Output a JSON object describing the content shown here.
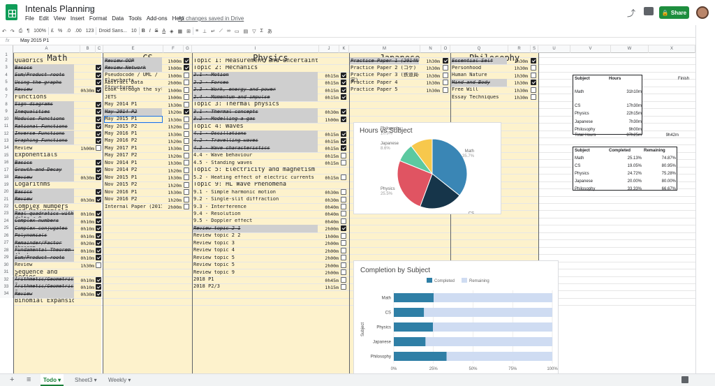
{
  "doc": {
    "title": "Intenals Planning",
    "menus": [
      "File",
      "Edit",
      "View",
      "Insert",
      "Format",
      "Data",
      "Tools",
      "Add-ons",
      "Help"
    ],
    "saved": "All changes saved in Drive",
    "share": "Share"
  },
  "toolbar": {
    "zoom": "100%",
    "currency": "£",
    "percent": "%",
    "dec0": ".0",
    "dec00": ".00",
    "format": "123",
    "font": "Droid Sans...",
    "size": "10",
    "bold": "B",
    "italic": "I",
    "strike": "S",
    "underline": "A"
  },
  "formula": {
    "fx": "fx",
    "value": "May 2015 P1"
  },
  "columns": [
    "A",
    "B",
    "C",
    "E",
    "F",
    "G",
    "I",
    "J",
    "K",
    "M",
    "N",
    "O",
    "Q",
    "R",
    "S",
    "U",
    "V",
    "W",
    "X"
  ],
  "subjects": [
    "Math",
    "CS",
    "Physics",
    "Japanese",
    "Philosophy"
  ],
  "rows": [
    "1",
    "2",
    "3",
    "4",
    "5",
    "6",
    "7",
    "8",
    "9",
    "10",
    "11",
    "12",
    "13",
    "14",
    "15",
    "16",
    "17",
    "18",
    "19",
    "20",
    "21",
    "22",
    "23",
    "24",
    "25",
    "26",
    "27",
    "28",
    "29",
    "30",
    "31",
    "32",
    "33",
    "34"
  ],
  "math": [
    {
      "r": 2,
      "t": "Quadrics",
      "big": true
    },
    {
      "r": 3,
      "t": "Basics",
      "d": true,
      "c": true
    },
    {
      "r": 4,
      "t": "Sum/Product roots",
      "d": true,
      "c": true
    },
    {
      "r": 5,
      "t": "Using the graphs",
      "d": true,
      "c": true
    },
    {
      "r": 6,
      "t": "Review",
      "d": true,
      "tm": "0h30m",
      "c": true
    },
    {
      "r": 7,
      "t": "Functions",
      "big": true
    },
    {
      "r": 8,
      "t": "Sign diagrams",
      "d": true,
      "c": true
    },
    {
      "r": 9,
      "t": "Inequalities",
      "d": true,
      "c": true
    },
    {
      "r": 10,
      "t": "Modulus Functions",
      "d": true,
      "c": true
    },
    {
      "r": 11,
      "t": "Rational Functions",
      "d": true,
      "c": true
    },
    {
      "r": 12,
      "t": "Inverse Functions",
      "d": true,
      "c": true
    },
    {
      "r": 13,
      "t": "Graphing Functions",
      "d": true,
      "c": true
    },
    {
      "r": 14,
      "t": "Review",
      "tm": "1h00m",
      "c": false
    },
    {
      "r": 15,
      "t": "Exponentials",
      "big": true
    },
    {
      "r": 16,
      "t": "Basics",
      "d": true,
      "c": true
    },
    {
      "r": 17,
      "t": "Growth and Decay",
      "d": true,
      "c": true
    },
    {
      "r": 18,
      "t": "Review",
      "d": true,
      "tm": "0h30m",
      "c": true
    },
    {
      "r": 19,
      "t": "Logarithms",
      "big": true
    },
    {
      "r": 20,
      "t": "Basics",
      "d": true,
      "c": true
    },
    {
      "r": 21,
      "t": "Review",
      "d": true,
      "tm": "0h30m",
      "c": true
    },
    {
      "r": 22,
      "t": "Complex Numbers",
      "t2": "and Polynomials",
      "big": true
    },
    {
      "r": 23,
      "t": "Real quadratics with",
      "t2": "delta < 0",
      "d": true,
      "tm": "0h10m",
      "c": true
    },
    {
      "r": 24,
      "t": "Complex numbers",
      "d": true,
      "tm": "0h10m",
      "c": true
    },
    {
      "r": 25,
      "t": "Complex conjugates",
      "d": true,
      "tm": "0h10m",
      "c": true
    },
    {
      "r": 26,
      "t": "Polynomials",
      "d": true,
      "tm": "0h10m",
      "c": true
    },
    {
      "r": 27,
      "t": "Remainder/Factor",
      "t2": "theorem",
      "d": true,
      "tm": "0h20m",
      "c": true
    },
    {
      "r": 28,
      "t": "Fundamental Theorem of",
      "t2": "Algebra",
      "d": true,
      "tm": "0h10m",
      "c": true
    },
    {
      "r": 29,
      "t": "Sum/Product roots",
      "d": true,
      "tm": "0h10m",
      "c": true
    },
    {
      "r": 30,
      "t": "Review",
      "tm": "1h30m",
      "c": false
    },
    {
      "r": 31,
      "t": "Sequence and",
      "t2": "Series",
      "big": true
    },
    {
      "r": 32,
      "t": "Arithmetic/Geometric",
      "t2": "Sequences",
      "d": true,
      "tm": "0h10m",
      "c": true
    },
    {
      "r": 33,
      "t": "Arithmetic/Geometric",
      "t2": "Series",
      "d": true,
      "tm": "0h10m",
      "c": true
    },
    {
      "r": 34,
      "t": "Review",
      "d": true,
      "tm": "0h30m",
      "c": true
    },
    {
      "r": 35,
      "t": "Binomial Expansion",
      "big": true
    }
  ],
  "cs": [
    {
      "r": 2,
      "t": "Review OOP",
      "d": true,
      "tm": "1h00m",
      "c": true
    },
    {
      "r": 3,
      "t": "Review Network",
      "d": true,
      "tm": "1h00m",
      "c": true
    },
    {
      "r": 4,
      "t": "Pseudocode / UML /",
      "t2": "Flowcharts",
      "tm": "1h00m",
      "c": false
    },
    {
      "r": 5,
      "t": "Abstract Data",
      "t2": "Structures",
      "tm": "2h00m",
      "c": false
    },
    {
      "r": 6,
      "t": "Look through the syllab",
      "tm": "1h00m",
      "c": false
    },
    {
      "r": 7,
      "t": "JETS",
      "tm": "1h00m",
      "c": false
    },
    {
      "r": 8,
      "t": "May 2014 P1",
      "tm": "1h30m",
      "c": false
    },
    {
      "r": 9,
      "t": "May 2014 P2",
      "d": true,
      "tm": "1h20m",
      "c": true
    },
    {
      "r": 10,
      "t": "May 2015 P1",
      "tm": "1h30m",
      "c": false,
      "sel": true
    },
    {
      "r": 11,
      "t": "May 2015 P2",
      "tm": "1h20m",
      "c": false
    },
    {
      "r": 12,
      "t": "May 2016 P1",
      "tm": "1h30m",
      "c": false
    },
    {
      "r": 13,
      "t": "May 2016 P2",
      "tm": "1h20m",
      "c": false
    },
    {
      "r": 14,
      "t": "May 2017 P1",
      "tm": "1h30m",
      "c": false
    },
    {
      "r": 15,
      "t": "May 2017 P2",
      "tm": "1h20m",
      "c": false
    },
    {
      "r": 16,
      "t": "Nov 2014 P1",
      "tm": "1h30m",
      "c": false
    },
    {
      "r": 17,
      "t": "Nov 2014 P2",
      "tm": "1h20m",
      "c": false
    },
    {
      "r": 18,
      "t": "Nov 2015 P1",
      "tm": "1h30m",
      "c": false
    },
    {
      "r": 19,
      "t": "Nov 2015 P2",
      "tm": "1h20m",
      "c": false
    },
    {
      "r": 20,
      "t": "Nov 2016 P1",
      "tm": "1h30m",
      "c": false
    },
    {
      "r": 21,
      "t": "Nov 2016 P2",
      "tm": "1h20m",
      "c": false
    },
    {
      "r": 22,
      "t": "Internal Paper (2017A)",
      "tm": "2h00m",
      "c": false
    }
  ],
  "physics": [
    {
      "r": 2,
      "t": "Topic 1: Measurement and uncertainties",
      "big": true
    },
    {
      "r": 3,
      "t": "Topic 2: Mechanics",
      "big": true
    },
    {
      "r": 4,
      "t": "2.1 - Motion",
      "d": true,
      "tm": "0h15m",
      "c": true
    },
    {
      "r": 5,
      "t": "2.2 - Forces",
      "d": true,
      "tm": "0h15m",
      "c": true
    },
    {
      "r": 6,
      "t": "2.3 - Work, energy and power",
      "d": true,
      "tm": "0h15m",
      "c": true
    },
    {
      "r": 7,
      "t": "2.4 - Momentum and impulse",
      "d": true,
      "tm": "0h15m",
      "c": true
    },
    {
      "r": 8,
      "t": "Topic 3: Thermal physics",
      "big": true
    },
    {
      "r": 9,
      "t": "3.1 - Thermal concepts",
      "d": true,
      "tm": "0h30m",
      "c": true
    },
    {
      "r": 10,
      "t": "3.2 - Modelling a gas",
      "d": true,
      "tm": "1h00m",
      "c": true
    },
    {
      "r": 11,
      "t": "Topic 4: Waves",
      "big": true
    },
    {
      "r": 12,
      "t": "4.1 - Oscillations",
      "d": true,
      "tm": "0h15m",
      "c": true
    },
    {
      "r": 13,
      "t": "4.2 - Travelling waves",
      "d": true,
      "tm": "0h15m",
      "c": true
    },
    {
      "r": 14,
      "t": "4.3 - Wave characteristics",
      "d": true,
      "tm": "0h15m",
      "c": true
    },
    {
      "r": 15,
      "t": "4.4 - Wave behaviour",
      "tm": "0h15m",
      "c": false
    },
    {
      "r": 16,
      "t": "4.5 - Standing waves",
      "tm": "0h15m",
      "c": false
    },
    {
      "r": 17,
      "t": "Topic 5: Electricity and magnetism",
      "big": true
    },
    {
      "r": 18,
      "t": "5.2 - Heating effect of electric currents",
      "tm": "0h15m",
      "c": false
    },
    {
      "r": 19,
      "t": "Topic 9: HL Wave Phenomena",
      "big": true
    },
    {
      "r": 20,
      "t": "9.1 - Simple harmonic motion",
      "tm": "0h30m",
      "c": false
    },
    {
      "r": 21,
      "t": "9.2 - Single-slit diffraction",
      "tm": "0h30m",
      "c": false
    },
    {
      "r": 22,
      "t": "9.3 - Interference",
      "tm": "0h40m",
      "c": false
    },
    {
      "r": 23,
      "t": "9.4 - Resolution",
      "tm": "0h40m",
      "c": false
    },
    {
      "r": 24,
      "t": "9.5 - Doppler effect",
      "tm": "0h40m",
      "c": false
    },
    {
      "r": 25,
      "t": "Review topic 2 1",
      "d": true,
      "tm": "2h00m",
      "c": true
    },
    {
      "r": 26,
      "t": "Review topic 2 2",
      "tm": "1h00m",
      "c": false
    },
    {
      "r": 27,
      "t": "Review topic 3",
      "tm": "2h00m",
      "c": false
    },
    {
      "r": 28,
      "t": "Review topic 4",
      "tm": "2h00m",
      "c": false
    },
    {
      "r": 29,
      "t": "Review topic 5",
      "tm": "2h00m",
      "c": false
    },
    {
      "r": 30,
      "t": "Review topic 5",
      "tm": "2h00m",
      "c": false
    },
    {
      "r": 31,
      "t": "Review topic 9",
      "tm": "2h00m",
      "c": false
    },
    {
      "r": 32,
      "t": "2018 P1",
      "tm": "0h45m",
      "c": false
    },
    {
      "r": 33,
      "t": "2018 P2/3",
      "tm": "1h15m",
      "c": false
    }
  ],
  "japanese": [
    {
      "r": 2,
      "t": "Practice Paper 1 (2014N SL)",
      "d": true,
      "tm": "1h30m",
      "c": true
    },
    {
      "r": 3,
      "t": "Practice Paper 2 (コケ)",
      "tm": "1h30m",
      "c": false
    },
    {
      "r": 4,
      "t": "Practice Paper 3 (鉄道員の",
      "t2": "家)",
      "tm": "1h30m",
      "c": false
    },
    {
      "r": 5,
      "t": "Practice Paper 4",
      "tm": "1h30m",
      "c": false
    },
    {
      "r": 6,
      "t": "Practice Paper 5",
      "tm": "1h30m",
      "c": false
    }
  ],
  "philosophy": [
    {
      "r": 2,
      "t": "Essential Self",
      "d": true,
      "tm": "1h30m",
      "c": true
    },
    {
      "r": 3,
      "t": "Personhood",
      "tm": "1h30m",
      "c": false
    },
    {
      "r": 4,
      "t": "Human Nature",
      "tm": "1h30m",
      "c": false
    },
    {
      "r": 5,
      "t": "Mind and Body",
      "d": true,
      "tm": "1h30m",
      "c": true
    },
    {
      "r": 6,
      "t": "Free Will",
      "tm": "1h30m",
      "c": false
    },
    {
      "r": 7,
      "t": "Essay Techniques",
      "tm": "1h30m",
      "c": false
    }
  ],
  "hours_table": {
    "header": [
      "Subject",
      "Hours"
    ],
    "finish": "Finish",
    "rows": [
      [
        "Math",
        "31h10m"
      ],
      [
        "CS",
        "17h30m"
      ],
      [
        "Physics",
        "22h15m"
      ],
      [
        "Japanese",
        "7h30m"
      ],
      [
        "Philosophy",
        "9h00m"
      ]
    ],
    "total": [
      "Total Hours",
      "87h25m",
      "9h42m"
    ]
  },
  "completion_table": {
    "header": [
      "Subject",
      "Completed",
      "Remaining"
    ],
    "rows": [
      [
        "Math",
        "25.13%",
        "74.87%"
      ],
      [
        "CS",
        "19.05%",
        "80.95%"
      ],
      [
        "Physics",
        "24.72%",
        "75.28%"
      ],
      [
        "Japanese",
        "20.00%",
        "80.00%"
      ],
      [
        "Philosophy",
        "33.33%",
        "66.67%"
      ]
    ]
  },
  "chart_data": [
    {
      "type": "pie",
      "title": "Hours vs Subject",
      "labels": [
        "Math",
        "CS",
        "Physics",
        "Japanese",
        "Philosophy"
      ],
      "values": [
        35.7,
        20.0,
        25.5,
        8.6,
        10.3
      ],
      "value_labels": [
        "35.7%",
        "20.0%",
        "25.5%",
        "8.6%",
        "10.3%"
      ],
      "colors": [
        "#3a86b5",
        "#16354a",
        "#e05462",
        "#5cc9a0",
        "#f7c84c"
      ]
    },
    {
      "type": "bar",
      "title": "Completion by Subject",
      "categories": [
        "Math",
        "CS",
        "Physics",
        "Japanese",
        "Philosophy"
      ],
      "series": [
        {
          "name": "Completed",
          "values": [
            25.13,
            19.05,
            24.72,
            20.0,
            33.33
          ],
          "color": "#2f7fa6"
        },
        {
          "name": "Remaining",
          "values": [
            74.87,
            80.95,
            75.28,
            80.0,
            66.67
          ],
          "color": "#cfdcf2"
        }
      ],
      "xlabel": "Completion",
      "ylabel": "Subject",
      "xlim": [
        0,
        100
      ],
      "xticks": [
        "0%",
        "25%",
        "50%",
        "75%",
        "100%"
      ]
    }
  ],
  "tabs": {
    "add": "+",
    "list": "≡",
    "items": [
      "Todo",
      "Sheet3",
      "Weekly"
    ]
  }
}
